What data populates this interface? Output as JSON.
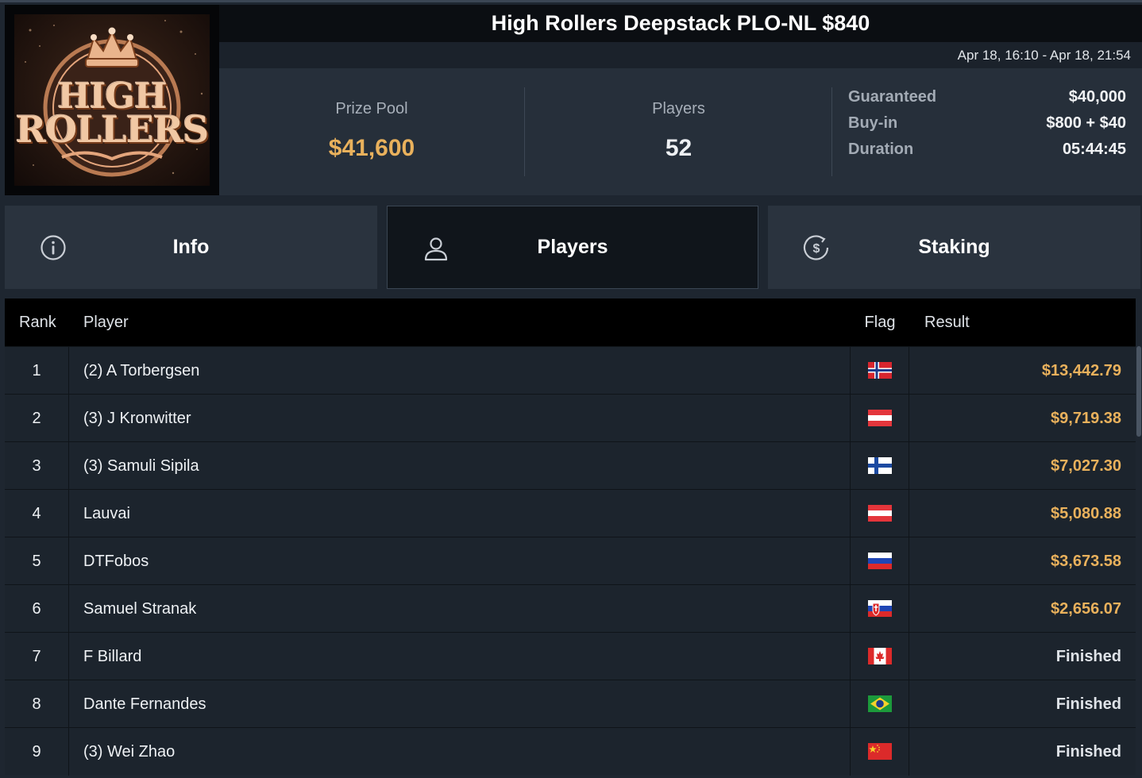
{
  "header": {
    "title": "High Rollers Deepstack PLO-NL $840",
    "date_range": "Apr 18, 16:10 - Apr 18, 21:54",
    "logo_text": [
      "HIGH",
      "ROLLERS"
    ]
  },
  "stats": {
    "prize_pool_label": "Prize Pool",
    "prize_pool_value": "$41,600",
    "players_label": "Players",
    "players_value": "52",
    "details": [
      {
        "label": "Guaranteed",
        "value": "$40,000"
      },
      {
        "label": "Buy-in",
        "value": "$800 + $40"
      },
      {
        "label": "Duration",
        "value": "05:44:45"
      }
    ]
  },
  "tabs": [
    {
      "label": "Info",
      "icon": "info-icon",
      "active": false
    },
    {
      "label": "Players",
      "icon": "user-icon",
      "active": true
    },
    {
      "label": "Staking",
      "icon": "dollar-coin-icon",
      "active": false
    }
  ],
  "table": {
    "headers": {
      "rank": "Rank",
      "player": "Player",
      "flag": "Flag",
      "result": "Result"
    },
    "rows": [
      {
        "rank": "1",
        "player": "(2) A Torbergsen",
        "flag": "norway",
        "result": "$13,442.79",
        "paid": true
      },
      {
        "rank": "2",
        "player": "(3) J Kronwitter",
        "flag": "austria",
        "result": "$9,719.38",
        "paid": true
      },
      {
        "rank": "3",
        "player": "(3) Samuli Sipila",
        "flag": "finland",
        "result": "$7,027.30",
        "paid": true
      },
      {
        "rank": "4",
        "player": "Lauvai",
        "flag": "austria",
        "result": "$5,080.88",
        "paid": true
      },
      {
        "rank": "5",
        "player": "DTFobos",
        "flag": "russia",
        "result": "$3,673.58",
        "paid": true
      },
      {
        "rank": "6",
        "player": "Samuel Stranak",
        "flag": "slovakia",
        "result": "$2,656.07",
        "paid": true
      },
      {
        "rank": "7",
        "player": "F Billard",
        "flag": "canada",
        "result": "Finished",
        "paid": false
      },
      {
        "rank": "8",
        "player": "Dante Fernandes",
        "flag": "brazil",
        "result": "Finished",
        "paid": false
      },
      {
        "rank": "9",
        "player": "(3) Wei Zhao",
        "flag": "china",
        "result": "Finished",
        "paid": false
      }
    ]
  },
  "colors": {
    "gold": "#e9b15c",
    "background": "#1e2630",
    "header_black": "#000000"
  }
}
